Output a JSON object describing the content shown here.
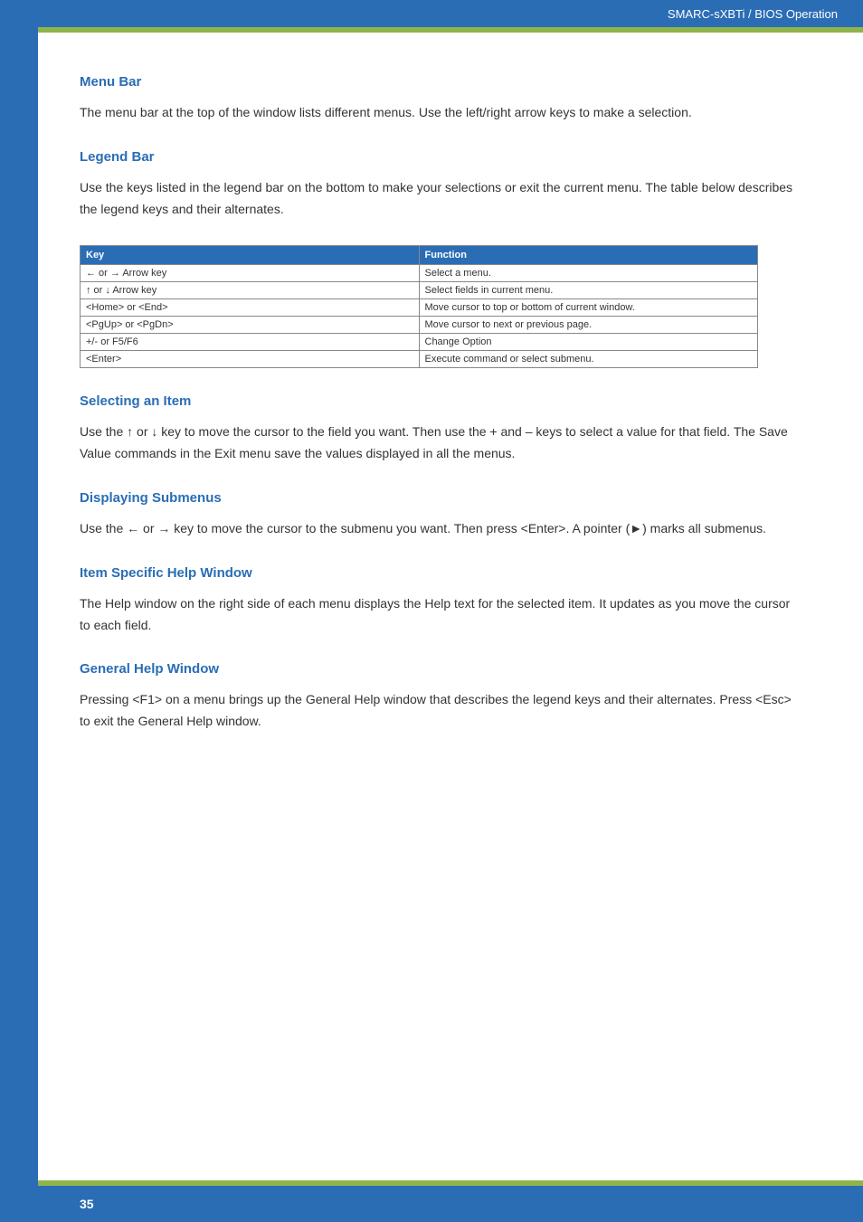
{
  "header": {
    "breadcrumb": "SMARC-sXBTi / BIOS Operation"
  },
  "sections": {
    "menu_bar": {
      "title": "Menu Bar",
      "text": "The menu bar at the top of the window lists different menus. Use the left/right arrow keys to make a selection."
    },
    "legend_bar": {
      "title": "Legend Bar",
      "text": "Use the keys listed in the legend bar on the bottom to make your selections or exit the current menu. The table below describes the legend keys and their alternates."
    },
    "selecting_item": {
      "title": "Selecting an Item",
      "text": "Use the ↑ or ↓ key to move the cursor to the field you want. Then use the + and – keys to select a value for that field. The Save Value commands in the Exit menu save the values displayed in all the menus."
    },
    "displaying_submenus": {
      "title": "Displaying Submenus",
      "text": "Use the ← or → key to move the cursor to the submenu you want. Then press <Enter>. A pointer (►) marks all submenus."
    },
    "item_help": {
      "title": "Item Specific Help Window",
      "text": "The Help window on the right side of each menu displays the Help text for the selected item. It updates as you move the cursor to each field."
    },
    "general_help": {
      "title": "General Help Window",
      "text": "Pressing <F1> on a menu brings up the General Help window that describes the legend keys and their alternates. Press <Esc> to exit the General Help window."
    }
  },
  "table": {
    "headers": {
      "key": "Key",
      "function": "Function"
    },
    "rows": [
      {
        "key": "← or → Arrow key",
        "function": "Select a menu."
      },
      {
        "key": "↑ or ↓ Arrow key",
        "function": "Select fields in current menu."
      },
      {
        "key": "<Home> or <End>",
        "function": "Move cursor to top or bottom of current window."
      },
      {
        "key": "<PgUp> or <PgDn>",
        "function": "Move cursor to next or previous page."
      },
      {
        "key": "+/- or F5/F6",
        "function": "Change Option"
      },
      {
        "key": "<Enter>",
        "function": "Execute command or select submenu."
      }
    ]
  },
  "footer": {
    "page": "35"
  }
}
